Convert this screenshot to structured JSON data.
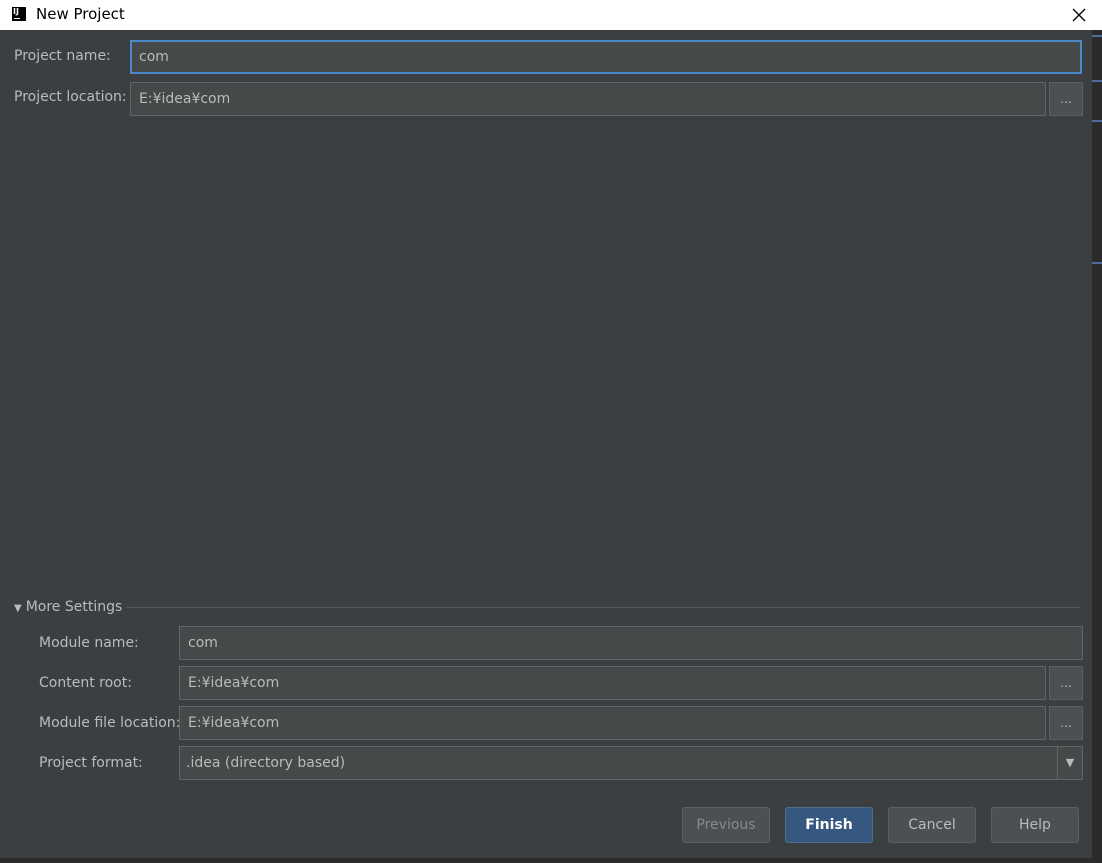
{
  "window": {
    "title": "New Project"
  },
  "project": {
    "name_label": "Project name:",
    "name_value": "com",
    "location_label": "Project location:",
    "location_value": "E:¥idea¥com",
    "browse_label": "..."
  },
  "more_settings": {
    "toggle_label": "More Settings",
    "module_name_label": "Module name:",
    "module_name_value": "com",
    "content_root_label": "Content root:",
    "content_root_value": "E:¥idea¥com",
    "module_file_label": "Module file location:",
    "module_file_value": "E:¥idea¥com",
    "format_label": "Project format:",
    "format_value": ".idea (directory based)",
    "browse_label": "..."
  },
  "buttons": {
    "previous": "Previous",
    "finish": "Finish",
    "cancel": "Cancel",
    "help": "Help"
  }
}
